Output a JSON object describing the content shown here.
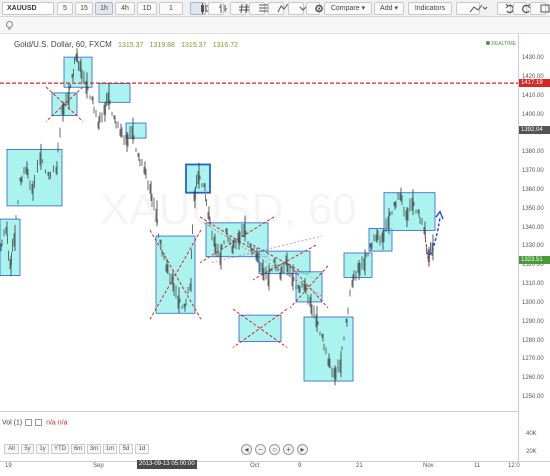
{
  "toolbar": {
    "symbol": "XAUUSD",
    "intervals": [
      "5",
      "15",
      "1h",
      "4h",
      "1D",
      "1"
    ],
    "active_interval": "1h",
    "compare": "Compare",
    "add": "Add",
    "indicators": "Indicators"
  },
  "legend": {
    "title": "Gold/U.S. Dollar, 60, FXCM",
    "o": "1315.37",
    "h": "1319.88",
    "l": "1315.37",
    "c": "1316.72"
  },
  "realtime_label": "REALTIME",
  "watermark": "XAUUSD, 60",
  "price_axis": {
    "ticks": [
      "1430.00",
      "1420.00",
      "1410.00",
      "1400.00",
      "1390.00",
      "1380.00",
      "1370.00",
      "1360.00",
      "1350.00",
      "1340.00",
      "1330.00",
      "1320.00",
      "1310.00",
      "1300.00",
      "1290.00",
      "1280.00",
      "1270.00",
      "1260.00",
      "1250.00"
    ],
    "tags": [
      {
        "text": "1417.19",
        "color": "#d62728"
      },
      {
        "text": "1392.04",
        "color": "#555555"
      },
      {
        "text": "1323.51",
        "color": "#4a9a3a"
      }
    ]
  },
  "volume": {
    "label": "Vol (1)",
    "na1": "n/a",
    "na2": "n/a",
    "ticks": [
      "40K",
      "20K"
    ]
  },
  "ranges": [
    "All",
    "5y",
    "1y",
    "YTD",
    "6m",
    "3m",
    "1m",
    "5d",
    "1d"
  ],
  "time_axis": {
    "ticks": [
      "19",
      "Sep",
      "Oct",
      "9",
      "21",
      "Nov",
      "11",
      "12:0"
    ],
    "highlight": "2013-09-13 05:00:00"
  },
  "colors": {
    "box_fill": "#8fefea",
    "box_border": "#2a62c8",
    "hline": "#d62728",
    "cross": "#d62728",
    "candle": "#333333"
  }
}
